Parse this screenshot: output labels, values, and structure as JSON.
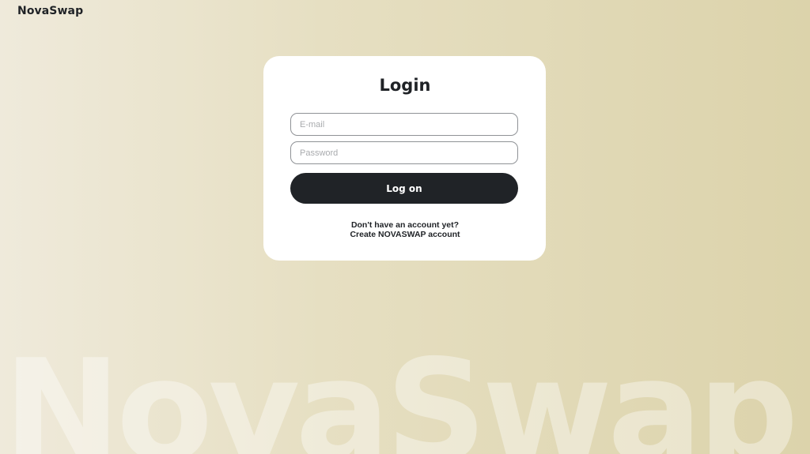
{
  "header": {
    "brand": "NovaSwap"
  },
  "background": {
    "watermark_text": "NovaSwap"
  },
  "login_card": {
    "title": "Login",
    "email_placeholder": "E-mail",
    "password_placeholder": "Password",
    "submit_label": "Log on",
    "signup_prompt": "Don't have an account yet?",
    "signup_link": "Create NOVASWAP account"
  },
  "colors": {
    "button_bg": "#202327",
    "card_bg": "#ffffff",
    "page_bg_start": "#efeadb",
    "page_bg_end": "#dcd3ab"
  }
}
